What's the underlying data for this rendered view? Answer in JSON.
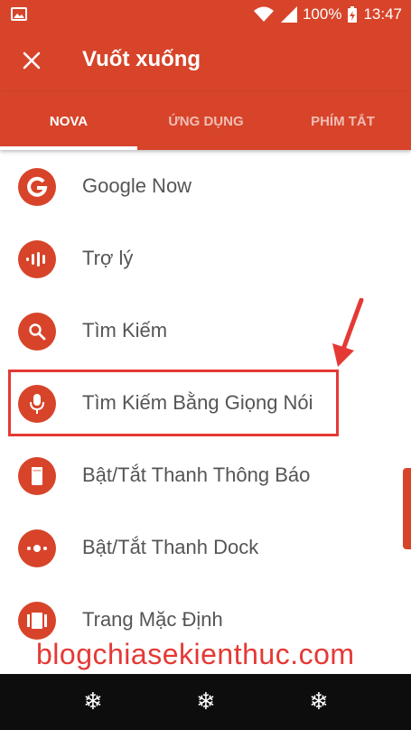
{
  "status_bar": {
    "battery": "100%",
    "time": "13:47",
    "icons": [
      "image-icon",
      "wifi-icon",
      "signal-icon",
      "battery-charging-icon"
    ]
  },
  "app_bar": {
    "title": "Vuốt xuống",
    "close_icon": "close-icon"
  },
  "tabs": [
    {
      "label": "NOVA",
      "selected": true
    },
    {
      "label": "ỨNG DỤNG",
      "selected": false
    },
    {
      "label": "PHÍM TẮT",
      "selected": false
    }
  ],
  "items": [
    {
      "label": "Google Now",
      "icon": "google-icon"
    },
    {
      "label": "Trợ lý",
      "icon": "assistant-icon"
    },
    {
      "label": "Tìm Kiếm",
      "icon": "search-icon"
    },
    {
      "label": "Tìm Kiếm Bằng Giọng Nói",
      "icon": "microphone-icon"
    },
    {
      "label": "Bật/Tắt Thanh Thông Báo",
      "icon": "phone-icon"
    },
    {
      "label": "Bật/Tắt Thanh Dock",
      "icon": "dock-icon"
    },
    {
      "label": "Trang Mặc Định",
      "icon": "pages-icon"
    }
  ],
  "watermark": "blogchiasekienthuc.com",
  "nav_bar": {
    "buttons": [
      "❄",
      "❄",
      "❄"
    ]
  },
  "colors": {
    "accent": "#d7442a",
    "highlight": "#e53935"
  }
}
